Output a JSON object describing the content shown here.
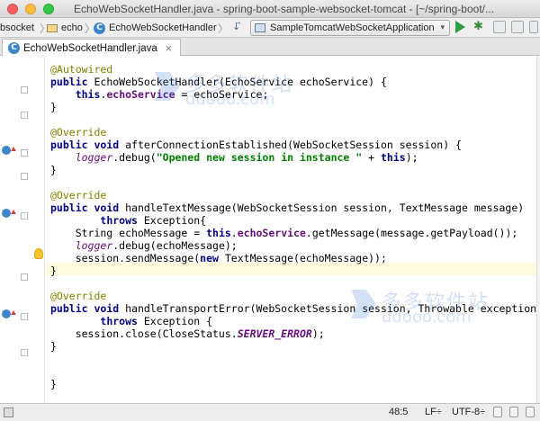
{
  "window": {
    "title": "EchoWebSocketHandler.java - spring-boot-sample-websocket-tomcat - [~/spring-boot/..."
  },
  "navbar": {
    "crumbs": [
      "bsocket",
      "echo",
      "EchoWebSocketHandler"
    ],
    "class_icon_letter": "C",
    "run_config": "SampleTomcatWebSocketApplication"
  },
  "tabs": [
    {
      "label": "EchoWebSocketHandler.java",
      "close": "×",
      "active": true
    }
  ],
  "editor": {
    "lines": [
      {
        "tokens": [
          {
            "t": "@Autowired",
            "c": "ann"
          }
        ]
      },
      {
        "tokens": [
          {
            "t": "public",
            "c": "kw"
          },
          {
            "t": " EchoWebSocketHandler(EchoService echoService) {"
          }
        ]
      },
      {
        "tokens": [
          {
            "t": "    "
          },
          {
            "t": "this",
            "c": "kw"
          },
          {
            "t": "."
          },
          {
            "t": "echoService",
            "c": "fld"
          },
          {
            "t": " = echoService;"
          }
        ]
      },
      {
        "tokens": [
          {
            "t": "}"
          }
        ]
      },
      {
        "tokens": []
      },
      {
        "tokens": [
          {
            "t": "@Override",
            "c": "ann"
          }
        ]
      },
      {
        "tokens": [
          {
            "t": "public void",
            "c": "kw"
          },
          {
            "t": " afterConnectionEstablished(WebSocketSession session) {"
          }
        ]
      },
      {
        "tokens": [
          {
            "t": "    "
          },
          {
            "t": "logger",
            "c": "log"
          },
          {
            "t": ".debug("
          },
          {
            "t": "\"Opened new session in instance \"",
            "c": "str"
          },
          {
            "t": " + "
          },
          {
            "t": "this",
            "c": "kw"
          },
          {
            "t": ");"
          }
        ]
      },
      {
        "tokens": [
          {
            "t": "}"
          }
        ]
      },
      {
        "tokens": []
      },
      {
        "tokens": [
          {
            "t": "@Override",
            "c": "ann"
          }
        ]
      },
      {
        "tokens": [
          {
            "t": "public void",
            "c": "kw"
          },
          {
            "t": " handleTextMessage(WebSocketSession session, TextMessage message)"
          }
        ]
      },
      {
        "tokens": [
          {
            "t": "        "
          },
          {
            "t": "throws",
            "c": "kw"
          },
          {
            "t": " Exception{"
          }
        ]
      },
      {
        "tokens": [
          {
            "t": "    String echoMessage = "
          },
          {
            "t": "this",
            "c": "kw"
          },
          {
            "t": "."
          },
          {
            "t": "echoService",
            "c": "fld"
          },
          {
            "t": ".getMessage(message.getPayload());"
          }
        ]
      },
      {
        "tokens": [
          {
            "t": "    "
          },
          {
            "t": "logger",
            "c": "log"
          },
          {
            "t": ".debug(echoMessage);"
          }
        ]
      },
      {
        "tokens": [
          {
            "t": "    session.sendMessage("
          },
          {
            "t": "new",
            "c": "kw"
          },
          {
            "t": " TextMessage(echoMessage));"
          }
        ]
      },
      {
        "tokens": [
          {
            "t": "}"
          }
        ]
      },
      {
        "tokens": []
      },
      {
        "tokens": [
          {
            "t": "@Override",
            "c": "ann"
          }
        ]
      },
      {
        "tokens": [
          {
            "t": "public void",
            "c": "kw"
          },
          {
            "t": " handleTransportError(WebSocketSession session, Throwable exception)"
          }
        ]
      },
      {
        "tokens": [
          {
            "t": "        "
          },
          {
            "t": "throws",
            "c": "kw"
          },
          {
            "t": " Exception {"
          }
        ]
      },
      {
        "tokens": [
          {
            "t": "    session.close(CloseStatus."
          },
          {
            "t": "SERVER_ERROR",
            "c": "cst"
          },
          {
            "t": ");"
          }
        ]
      },
      {
        "tokens": [
          {
            "t": "}"
          }
        ]
      },
      {
        "tokens": []
      },
      {
        "tokens": []
      },
      {
        "tokens": [
          {
            "t": "}"
          }
        ]
      }
    ]
  },
  "watermark": {
    "brand_cn": "多多软件站",
    "brand_en": "ddooo.com"
  },
  "statusbar": {
    "position": "48:5",
    "line_separator": "LF÷",
    "encoding": "UTF-8÷"
  }
}
